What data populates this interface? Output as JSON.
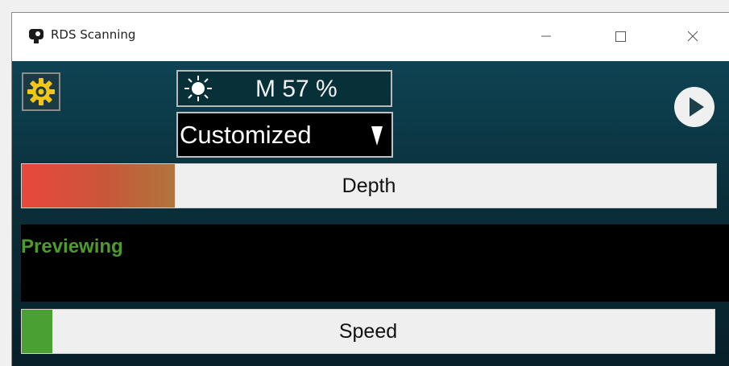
{
  "window": {
    "title": "RDS Scanning"
  },
  "controls": {
    "brightness_text": "M 57 %",
    "preset_value": "Customized",
    "depth_label": "Depth",
    "depth_level": 0.22,
    "status_text": "Previewing",
    "speed_label": "Speed",
    "speed_level": 0.044
  },
  "colors": {
    "background": "#0a2f3a",
    "gear": "#f5c518",
    "status_green": "#4e9a2e",
    "speed_fill": "#4aa032",
    "depth_fill_start": "#e8473d",
    "depth_fill_end": "#b0753c"
  },
  "icons": {
    "app": "camera-icon",
    "settings": "gear-icon",
    "brightness": "sun-icon",
    "dropdown": "dropdown-arrow-icon",
    "play": "play-icon",
    "minimize": "minimize-icon",
    "maximize": "maximize-icon",
    "close": "close-icon"
  }
}
